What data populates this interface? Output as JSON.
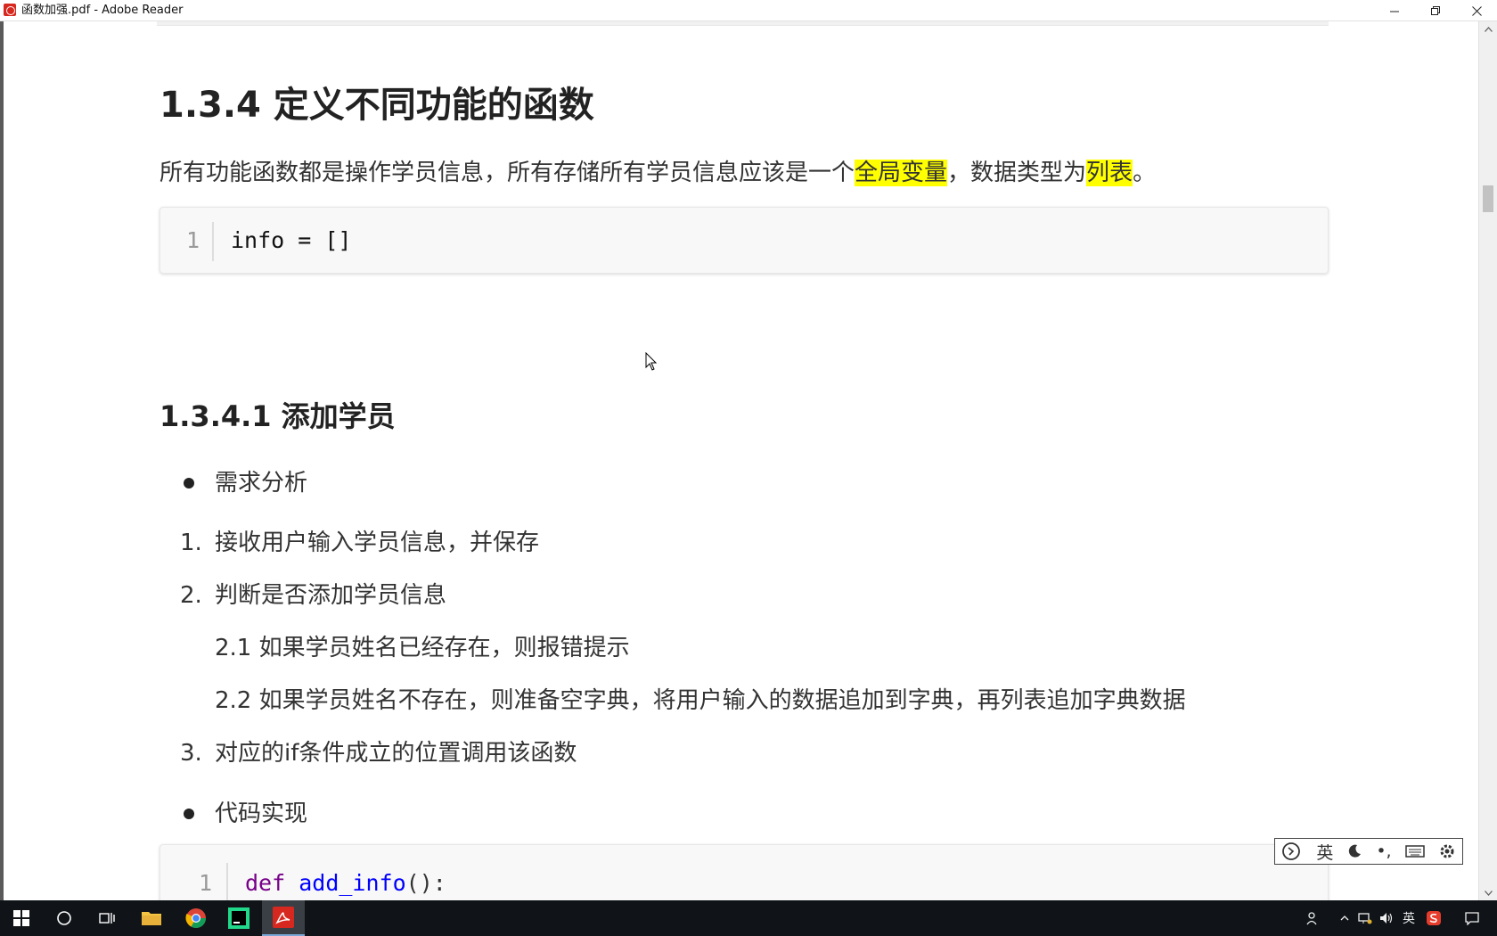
{
  "window": {
    "title": "函数加强.pdf - Adobe Reader",
    "minimize_label": "—",
    "restore_label": "❐",
    "close_label": "✕"
  },
  "document": {
    "section_heading": "1.3.4 定义不同功能的函数",
    "intro": {
      "part1": "所有功能函数都是操作学员信息，所有存储所有学员信息应该是一个",
      "highlight1": "全局变量",
      "part2": "，数据类型为",
      "highlight2": "列表",
      "part3": "。"
    },
    "code_block_1": {
      "line_number": "1",
      "code": "info = []"
    },
    "subsection_heading": "1.3.4.1 添加学员",
    "bullet_analysis": "需求分析",
    "steps": [
      {
        "number": "1.",
        "text": "接收用户输入学员信息，并保存"
      },
      {
        "number": "2.",
        "text": "判断是否添加学员信息"
      },
      {
        "number": "3.",
        "text": "对应的if条件成立的位置调用该函数"
      }
    ],
    "substeps": [
      "2.1 如果学员姓名已经存在，则报错提示",
      "2.2 如果学员姓名不存在，则准备空字典，将用户输入的数据追加到字典，再列表追加字典数据"
    ],
    "bullet_impl": "代码实现",
    "code_block_2": {
      "line_number": "1",
      "keyword": "def",
      "function_name": "add_info",
      "punctuation": "():"
    }
  },
  "ime": {
    "lang_label": "英",
    "moon_icon": "moon-icon",
    "punct_label": "•,",
    "keyboard_icon": "keyboard-icon",
    "settings_icon": "gear-icon"
  },
  "taskbar": {
    "tray_lang": "英"
  },
  "colors": {
    "highlight": "#ffff00",
    "keyword": "#770088",
    "function": "#0000ff",
    "taskbar": "#101418"
  }
}
